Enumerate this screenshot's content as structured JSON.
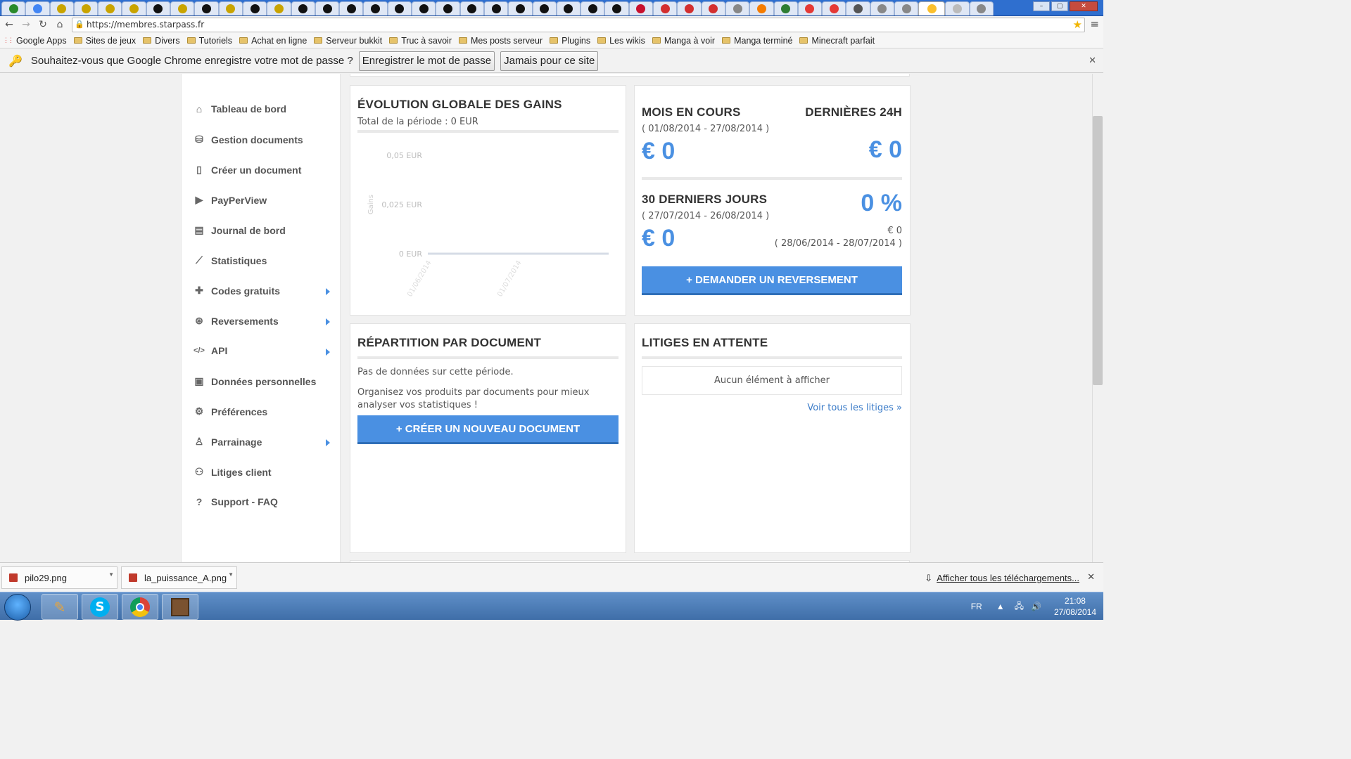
{
  "browser": {
    "url": "https://membres.starpass.fr",
    "bookmarks": [
      "Google Apps",
      "Sites de jeux",
      "Divers",
      "Tutoriels",
      "Achat en ligne",
      "Serveur bukkit",
      "Truc à savoir",
      "Mes posts serveur",
      "Plugins",
      "Les wikis",
      "Manga à voir",
      "Manga terminé",
      "Minecraft parfait"
    ],
    "infobar": {
      "message": "Souhaitez-vous que Google Chrome enregistre votre mot de passe ?",
      "save_label": "Enregistrer le mot de passe",
      "never_label": "Jamais pour ce site"
    }
  },
  "sidebar": {
    "items": [
      {
        "label": "Tableau de bord",
        "icon": "home-icon",
        "has_arrow": false
      },
      {
        "label": "Gestion documents",
        "icon": "drive-icon",
        "has_arrow": false
      },
      {
        "label": "Créer un document",
        "icon": "document-icon",
        "has_arrow": false
      },
      {
        "label": "PayPerView",
        "icon": "play-icon",
        "has_arrow": false
      },
      {
        "label": "Journal de bord",
        "icon": "newspaper-icon",
        "has_arrow": false
      },
      {
        "label": "Statistiques",
        "icon": "line-chart-icon",
        "has_arrow": false
      },
      {
        "label": "Codes gratuits",
        "icon": "gift-icon",
        "has_arrow": true
      },
      {
        "label": "Reversements",
        "icon": "money-icon",
        "has_arrow": true
      },
      {
        "label": "API",
        "icon": "code-icon",
        "has_arrow": true
      },
      {
        "label": "Données personnelles",
        "icon": "profile-icon",
        "has_arrow": false
      },
      {
        "label": "Préférences",
        "icon": "gear-icon",
        "has_arrow": false
      },
      {
        "label": "Parrainage",
        "icon": "user-tie-icon",
        "has_arrow": true
      },
      {
        "label": "Litiges client",
        "icon": "users-icon",
        "has_arrow": false
      },
      {
        "label": "Support - FAQ",
        "icon": "question-icon",
        "has_arrow": false
      }
    ]
  },
  "gains": {
    "title": "ÉVOLUTION GLOBALE DES GAINS",
    "subtitle": "Total de la période : 0 EUR"
  },
  "chart_data": {
    "type": "line",
    "title": "",
    "xlabel": "",
    "ylabel": "Gains",
    "yticks": [
      "0,05 EUR",
      "0,025 EUR",
      "0 EUR"
    ],
    "xticks": [
      "01/06/2014",
      "01/07/2014"
    ],
    "ylim": [
      0,
      0.05
    ],
    "series": [
      {
        "values": [
          0,
          0,
          0,
          0,
          0
        ]
      }
    ],
    "grid": false,
    "legend": "none"
  },
  "summary": {
    "month_label": "MOIS EN COURS",
    "last24_label": "DERNIÈRES 24H",
    "month_range": "( 01/08/2014 - 27/08/2014 )",
    "month_value": "€ 0",
    "last24_value": "€ 0",
    "days30_label": "30 DERNIERS JOURS",
    "days30_range": "( 27/07/2014 - 26/08/2014 )",
    "days30_value": "€ 0",
    "percent": "0 %",
    "prev_value": "€ 0",
    "prev_range": "( 28/06/2014 - 28/07/2014 )",
    "payout_button": "+ DEMANDER UN REVERSEMENT"
  },
  "repartition": {
    "title": "RÉPARTITION PAR DOCUMENT",
    "empty_text": "Pas de données sur cette période.",
    "hint_text": "Organisez vos produits par documents pour mieux analyser vos statistiques !",
    "create_button": "+ CRÉER UN NOUVEAU DOCUMENT"
  },
  "litiges": {
    "title": "LITIGES EN ATTENTE",
    "empty_text": "Aucun élément à afficher",
    "link": "Voir tous les litiges »"
  },
  "downloads": {
    "items": [
      "pilo29.png",
      "la_puissance_A.png"
    ],
    "show_all": "Afficher tous les téléchargements..."
  },
  "taskbar": {
    "lang": "FR",
    "time": "21:08",
    "date": "27/08/2014"
  },
  "colors": {
    "accent": "#4a90e2"
  }
}
